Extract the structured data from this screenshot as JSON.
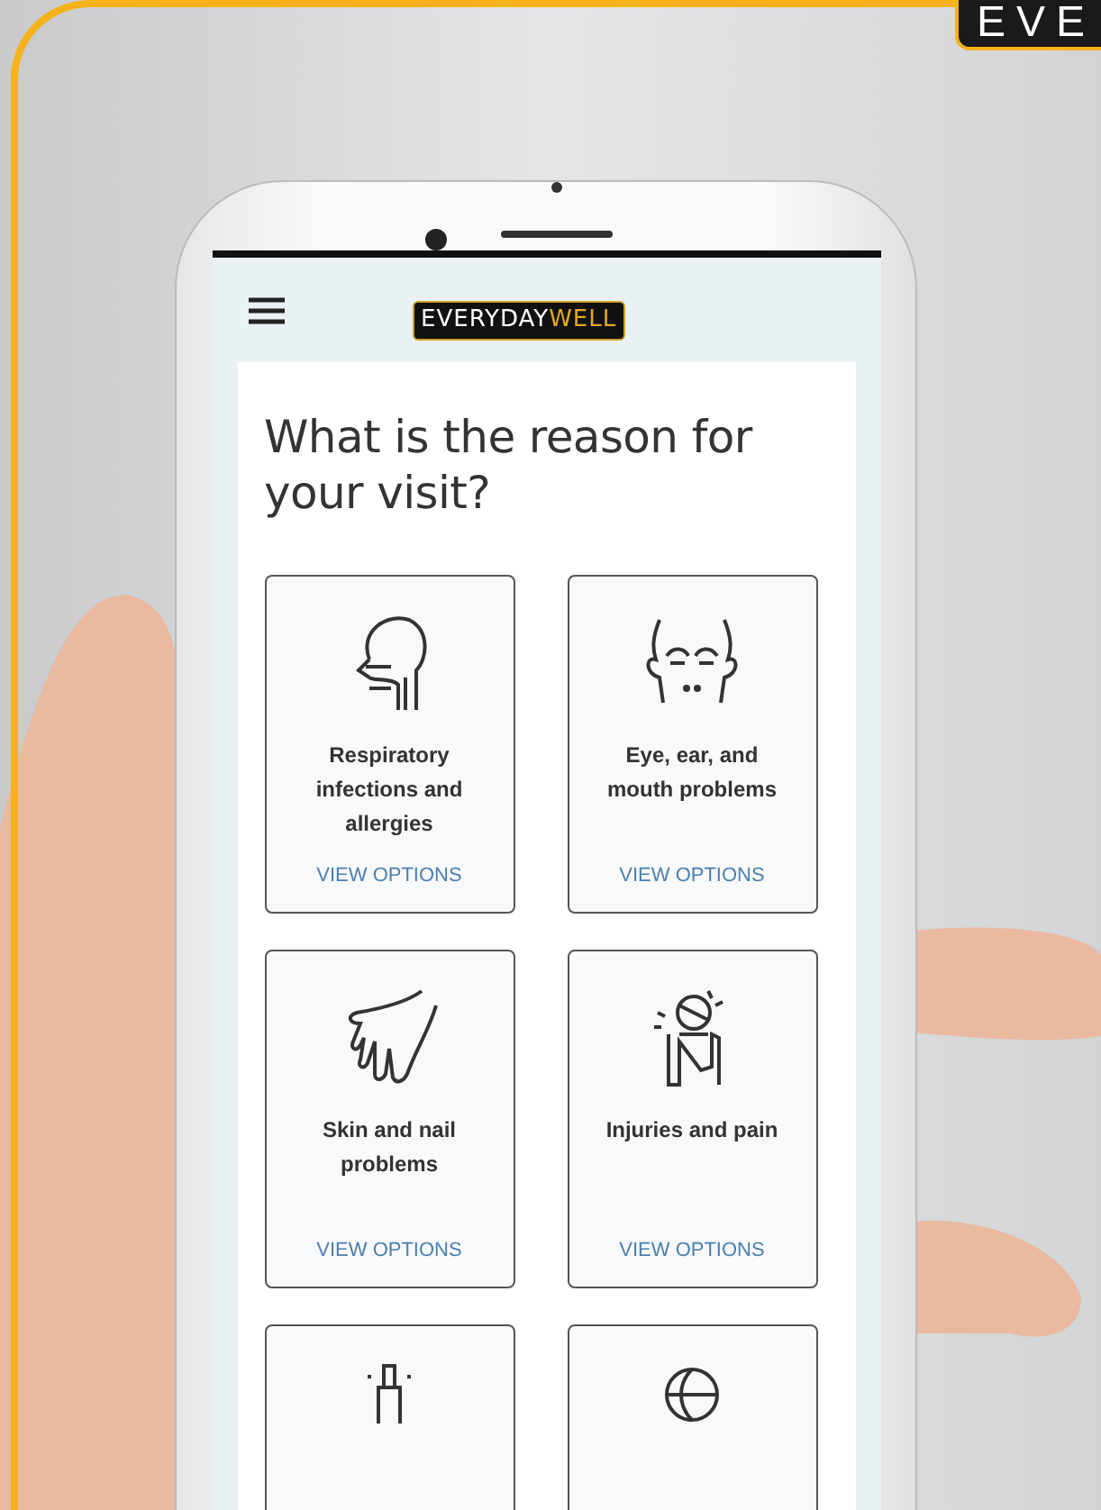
{
  "corner_tag": {
    "text": "EVE"
  },
  "app": {
    "logo": {
      "text": "EVERYDAY",
      "accent": "WELL"
    },
    "heading": "What is the reason for your visit?",
    "cards": [
      {
        "kind": "option",
        "title": "Respiratory infections and allergies",
        "link": "VIEW OPTIONS"
      },
      {
        "kind": "option",
        "title": "Eye, ear, and mouth problems",
        "link": "VIEW OPTIONS"
      },
      {
        "kind": "option",
        "title": "Skin and nail problems",
        "link": "VIEW OPTIONS"
      },
      {
        "kind": "option",
        "title": "Injuries and pain",
        "link": "VIEW OPTIONS"
      },
      {
        "kind": "partial"
      },
      {
        "kind": "partial"
      }
    ]
  }
}
